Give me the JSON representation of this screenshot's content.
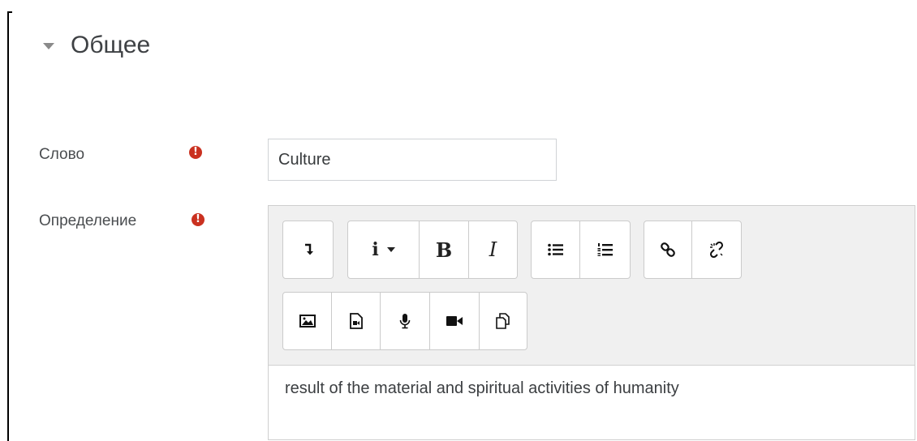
{
  "section": {
    "title": "Общее"
  },
  "fields": {
    "word": {
      "label": "Слово",
      "value": "Culture"
    },
    "definition": {
      "label": "Определение",
      "content": "result of the material and spiritual activities of humanity"
    }
  },
  "required_symbol": "!",
  "toolbar": {
    "row1": [
      [
        "collapse-toolbar-button"
      ],
      [
        "paragraph-styles-button",
        "bold-button",
        "italic-button"
      ],
      [
        "unordered-list-button",
        "ordered-list-button"
      ],
      [
        "link-button",
        "unlink-button"
      ]
    ],
    "row2": [
      [
        "insert-image-button",
        "insert-media-button",
        "record-audio-button",
        "record-video-button",
        "manage-files-button"
      ]
    ],
    "labels": {
      "bold": "B",
      "italic": "I",
      "info": "i"
    }
  },
  "colors": {
    "required": "#ca3120",
    "toolbar_bg": "#f0f0f0"
  }
}
